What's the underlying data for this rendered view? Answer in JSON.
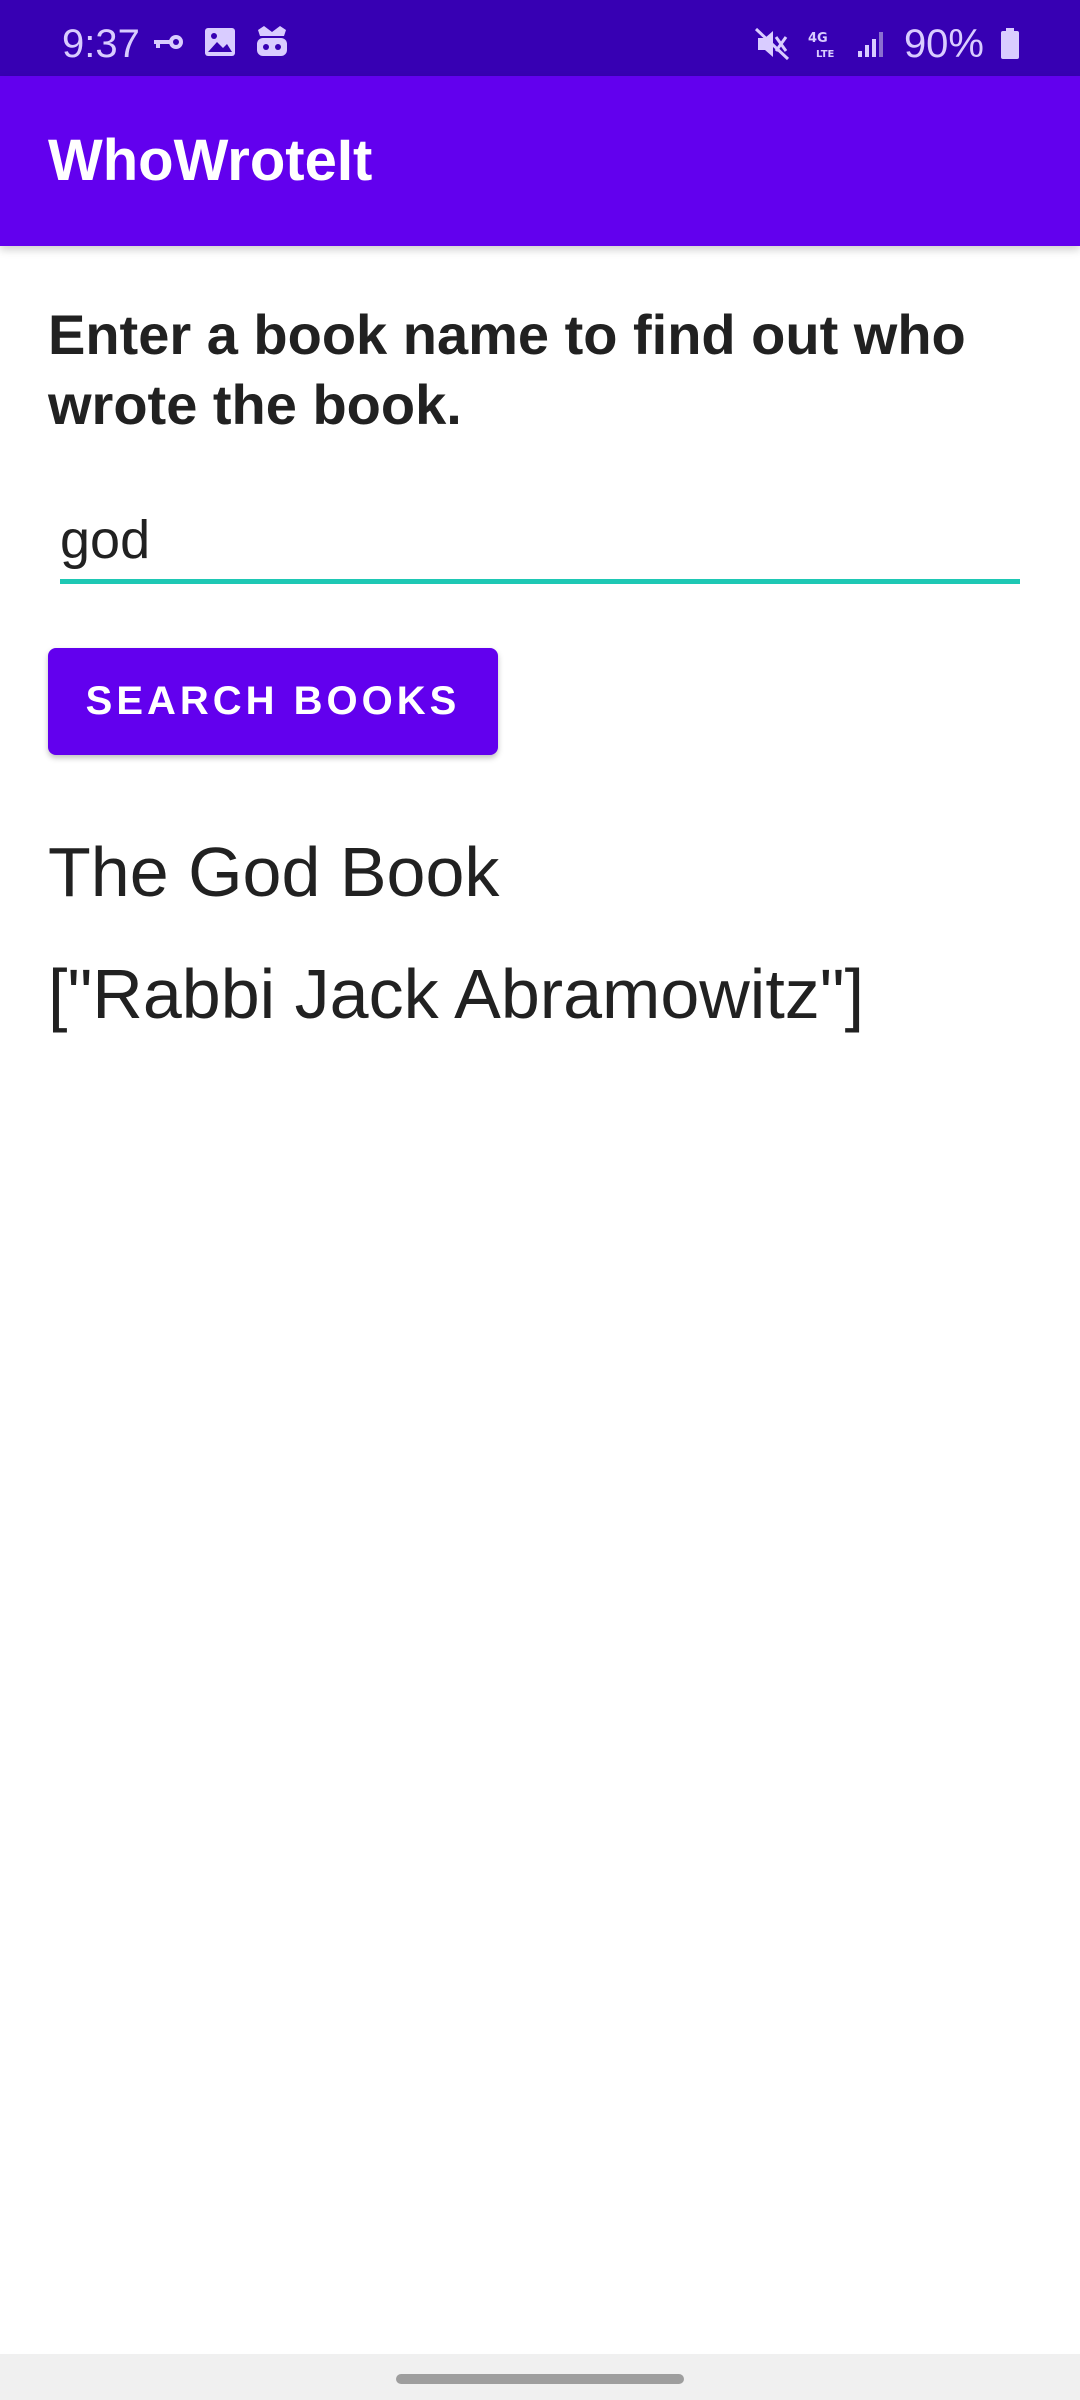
{
  "status_bar": {
    "time": "9:37",
    "battery": "90%",
    "icons_left": [
      "key-icon",
      "image-icon",
      "game-controller-icon"
    ],
    "icons_right": [
      "mute-vibrate-icon",
      "4g-lte-icon",
      "signal-icon",
      "battery-icon"
    ]
  },
  "app_bar": {
    "title": "WhoWroteIt"
  },
  "main": {
    "instructions": "Enter a book name to find out who wrote the book.",
    "search_value": "god",
    "search_button_label": "SEARCH BOOKS",
    "result_title": "The God Book",
    "result_authors": "[\"Rabbi Jack Abramowitz\"]"
  },
  "colors": {
    "status_bar": "#3700b3",
    "primary": "#6200ee",
    "accent": "#1ec8b4",
    "text": "#212121"
  }
}
